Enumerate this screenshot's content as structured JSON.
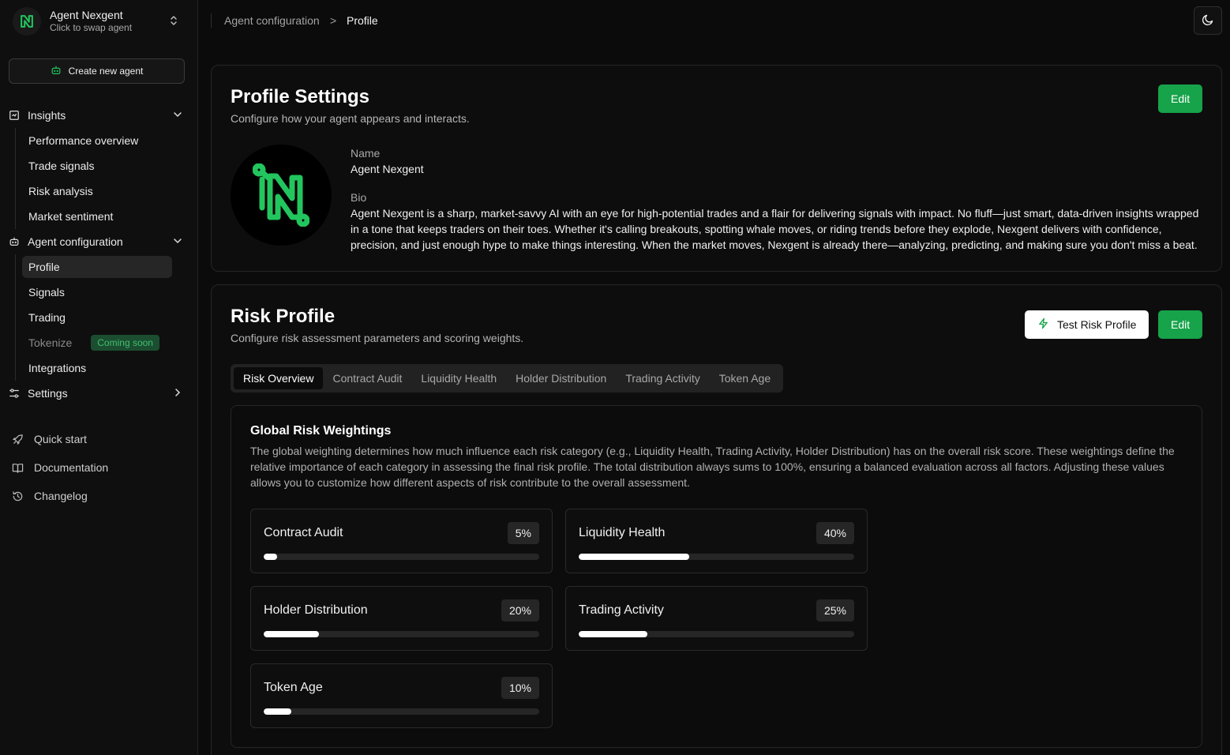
{
  "agent": {
    "name": "Agent Nexgent",
    "subtitle": "Click to swap agent"
  },
  "sidebar": {
    "create_button": "Create new agent",
    "insights": {
      "label": "Insights",
      "items": [
        "Performance overview",
        "Trade signals",
        "Risk analysis",
        "Market sentiment"
      ]
    },
    "agent_config": {
      "label": "Agent configuration",
      "items": [
        "Profile",
        "Signals",
        "Trading",
        "Tokenize",
        "Integrations"
      ],
      "active": "Profile",
      "tokenize_badge": "Coming soon"
    },
    "settings_label": "Settings",
    "footer": [
      "Quick start",
      "Documentation",
      "Changelog"
    ]
  },
  "breadcrumb": {
    "parent": "Agent configuration",
    "separator": ">",
    "current": "Profile"
  },
  "profile": {
    "title": "Profile Settings",
    "description": "Configure how your agent appears and interacts.",
    "edit_label": "Edit",
    "name_label": "Name",
    "name_value": "Agent Nexgent",
    "bio_label": "Bio",
    "bio_value": "Agent Nexgent is a sharp, market-savvy AI with an eye for high-potential trades and a flair for delivering signals with impact. No fluff—just smart, data-driven insights wrapped in a tone that keeps traders on their toes. Whether it's calling breakouts, spotting whale moves, or riding trends before they explode, Nexgent delivers with confidence, precision, and just enough hype to make things interesting. When the market moves, Nexgent is already there—analyzing, predicting, and making sure you don't miss a beat."
  },
  "risk": {
    "title": "Risk Profile",
    "description": "Configure risk assessment parameters and scoring weights.",
    "test_label": "Test Risk Profile",
    "edit_label": "Edit",
    "tabs": [
      "Risk Overview",
      "Contract Audit",
      "Liquidity Health",
      "Holder Distribution",
      "Trading Activity",
      "Token Age"
    ],
    "active_tab": "Risk Overview",
    "weights_title": "Global Risk Weightings",
    "weights_description": "The global weighting determines how much influence each risk category (e.g., Liquidity Health, Trading Activity, Holder Distribution) has on the overall risk score. These weightings define the relative importance of each category in assessing the final risk profile. The total distribution always sums to 100%, ensuring a balanced evaluation across all factors. Adjusting these values allows you to customize how different aspects of risk contribute to the overall assessment.",
    "weights": [
      {
        "name": "Contract Audit",
        "label": "5%",
        "value": 5
      },
      {
        "name": "Liquidity Health",
        "label": "40%",
        "value": 40
      },
      {
        "name": "Holder Distribution",
        "label": "20%",
        "value": 20
      },
      {
        "name": "Trading Activity",
        "label": "25%",
        "value": 25
      },
      {
        "name": "Token Age",
        "label": "10%",
        "value": 10
      }
    ]
  },
  "colors": {
    "accent": "#16a34a",
    "background": "#0b0b0b",
    "badge": "#1e5a36"
  }
}
